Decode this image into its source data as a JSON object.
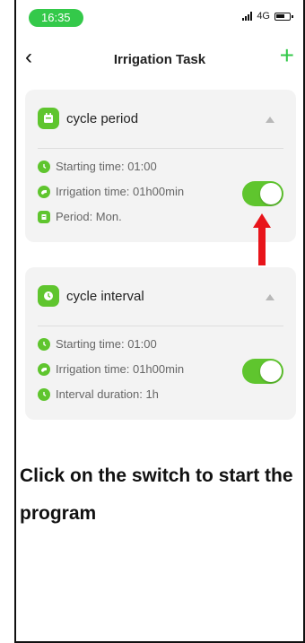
{
  "status_bar": {
    "time": "16:35",
    "network": "4G"
  },
  "nav": {
    "title": "Irrigation Task"
  },
  "cards": [
    {
      "title": "cycle period",
      "rows": [
        {
          "text": "Starting time: 01:00"
        },
        {
          "text": "Irrigation time: 01h00min"
        },
        {
          "text": "Period: Mon."
        }
      ],
      "enabled": true
    },
    {
      "title": "cycle interval",
      "rows": [
        {
          "text": "Starting time: 01:00"
        },
        {
          "text": "Irrigation time: 01h00min"
        },
        {
          "text": "Interval duration: 1h"
        }
      ],
      "enabled": true
    }
  ],
  "instruction": "Click on the switch to start the program",
  "colors": {
    "accent": "#5fc52e",
    "arrow": "#e8141a",
    "time_pill": "#34c94a"
  }
}
